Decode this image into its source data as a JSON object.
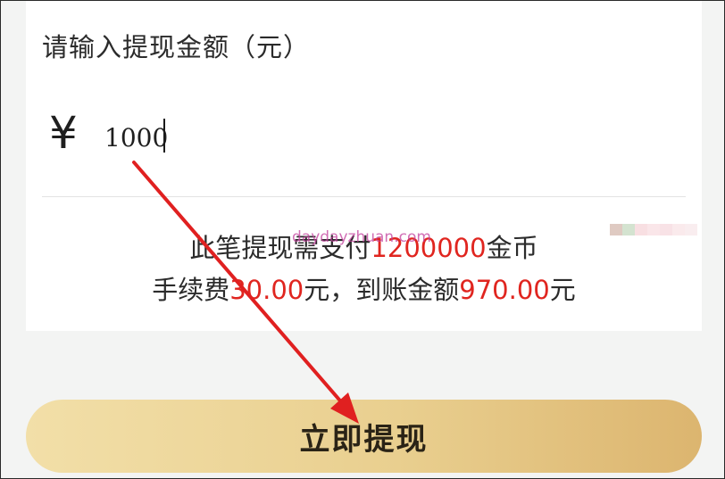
{
  "form": {
    "label": "请输入提现金额（元）",
    "currency_symbol": "¥",
    "amount_value": "1000"
  },
  "summary": {
    "line1_prefix": "此笔提现需支付",
    "line1_coins": "1200000",
    "line1_suffix": "金币",
    "line2_fee_prefix": "手续费",
    "line2_fee": "30.00",
    "line2_mid": "元，到账金额",
    "line2_net": "970.00",
    "line2_suffix": "元"
  },
  "watermark": "daydayzhuan.com",
  "button": {
    "label": "立即提现"
  },
  "colors": {
    "highlight": "#e0251f",
    "button_start": "#f2dfa8",
    "button_end": "#dcb56f",
    "annotation_arrow": "#e02020"
  }
}
